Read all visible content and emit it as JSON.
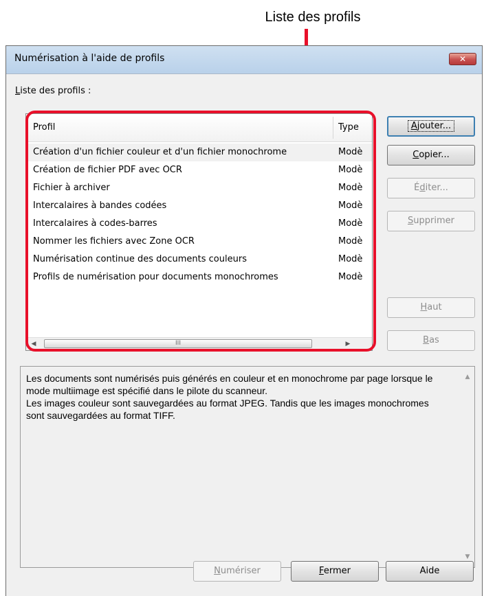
{
  "callout": {
    "label": "Liste des profils"
  },
  "dialog": {
    "title": "Numérisation à l'aide de profils",
    "close_glyph": "✕"
  },
  "list": {
    "caption_mnemonic": "L",
    "caption_rest": "iste des profils :",
    "columns": [
      "Profil",
      "Type"
    ],
    "rows": [
      {
        "name": "Création d'un fichier couleur et d'un fichier monochrome",
        "type": "Modè",
        "selected": true
      },
      {
        "name": "Création de fichier PDF avec OCR",
        "type": "Modè"
      },
      {
        "name": "Fichier à archiver",
        "type": "Modè"
      },
      {
        "name": "Intercalaires à bandes codées",
        "type": "Modè"
      },
      {
        "name": "Intercalaires à codes-barres",
        "type": "Modè"
      },
      {
        "name": "Nommer les fichiers avec Zone OCR",
        "type": "Modè"
      },
      {
        "name": "Numérisation continue des documents couleurs",
        "type": "Modè"
      },
      {
        "name": "Profils de numérisation pour documents monochromes",
        "type": "Modè"
      }
    ],
    "scroll_left": "◀",
    "scroll_right": "▶",
    "thumb_grip": "III"
  },
  "side_buttons": {
    "add": {
      "pre": "",
      "mn": "A",
      "post": "jouter..."
    },
    "copy": {
      "pre": "",
      "mn": "C",
      "post": "opier..."
    },
    "edit": {
      "pre": "É",
      "mn": "d",
      "post": "iter..."
    },
    "delete": {
      "pre": "",
      "mn": "S",
      "post": "upprimer"
    },
    "up": {
      "pre": "",
      "mn": "H",
      "post": "aut"
    },
    "down": {
      "pre": "",
      "mn": "B",
      "post": "as"
    }
  },
  "description": {
    "para1": "Les documents sont numérisés puis générés en couleur et en monochrome par page lorsque le mode multiimage est spécifié dans le pilote du scanneur.",
    "para2": "Les images couleur sont sauvegardées au format JPEG. Tandis que les images monochromes sont sauvegardées au format TIFF.",
    "scroll_up": "▲",
    "scroll_down": "▼"
  },
  "bottom_buttons": {
    "scan": {
      "pre": "",
      "mn": "N",
      "post": "umériser"
    },
    "close": {
      "pre": "",
      "mn": "F",
      "post": "ermer"
    },
    "help": {
      "label": "Aide"
    }
  },
  "colors": {
    "highlight": "#e8102a",
    "title_bar": "#b9d1ea",
    "dialog_bg": "#f0f0f0"
  }
}
